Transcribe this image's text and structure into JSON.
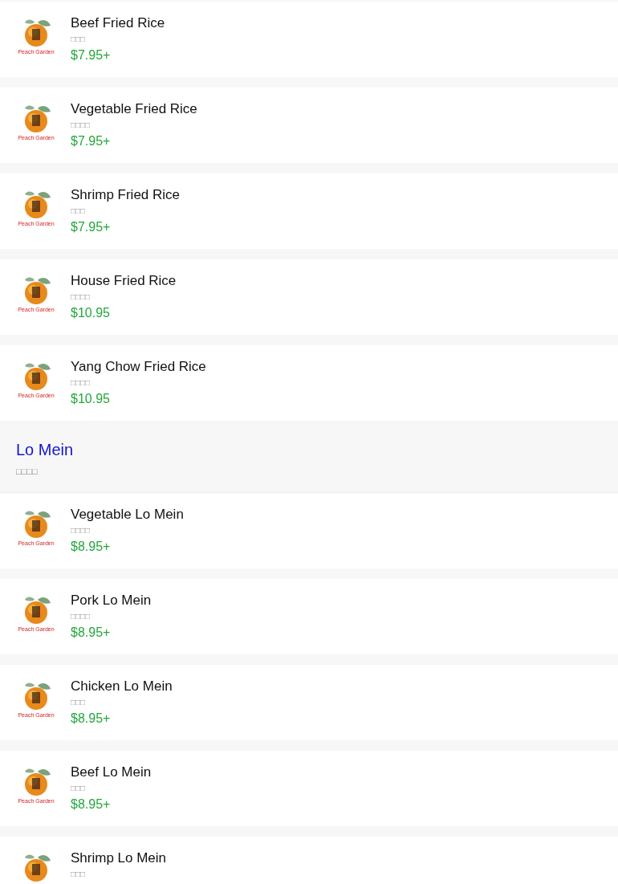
{
  "sections": [
    {
      "items": [
        {
          "name": "Beef Fried Rice",
          "subtitle": "□□□",
          "price": "$7.95+",
          "logo_text": "Peach Garden"
        },
        {
          "name": "Vegetable Fried Rice",
          "subtitle": "□□□□",
          "price": "$7.95+",
          "logo_text": "Peach Garden"
        },
        {
          "name": "Shrimp Fried Rice",
          "subtitle": "□□□",
          "price": "$7.95+",
          "logo_text": "Peach Garden"
        },
        {
          "name": "House Fried Rice",
          "subtitle": "□□□□",
          "price": "$10.95",
          "logo_text": "Peach Garden"
        },
        {
          "name": "Yang Chow Fried Rice",
          "subtitle": "□□□□",
          "price": "$10.95",
          "logo_text": "Peach Garden"
        }
      ]
    },
    {
      "title": "Lo Mein",
      "subtitle": "□□□□",
      "items": [
        {
          "name": "Vegetable Lo Mein",
          "subtitle": "□□□□",
          "price": "$8.95+",
          "logo_text": "Peach Garden"
        },
        {
          "name": "Pork Lo Mein",
          "subtitle": "□□□□",
          "price": "$8.95+",
          "logo_text": "Peach Garden"
        },
        {
          "name": "Chicken Lo Mein",
          "subtitle": "□□□",
          "price": "$8.95+",
          "logo_text": "Peach Garden"
        },
        {
          "name": "Beef Lo Mein",
          "subtitle": "□□□",
          "price": "$8.95+",
          "logo_text": "Peach Garden"
        },
        {
          "name": "Shrimp Lo Mein",
          "subtitle": "□□□"
        }
      ]
    }
  ]
}
